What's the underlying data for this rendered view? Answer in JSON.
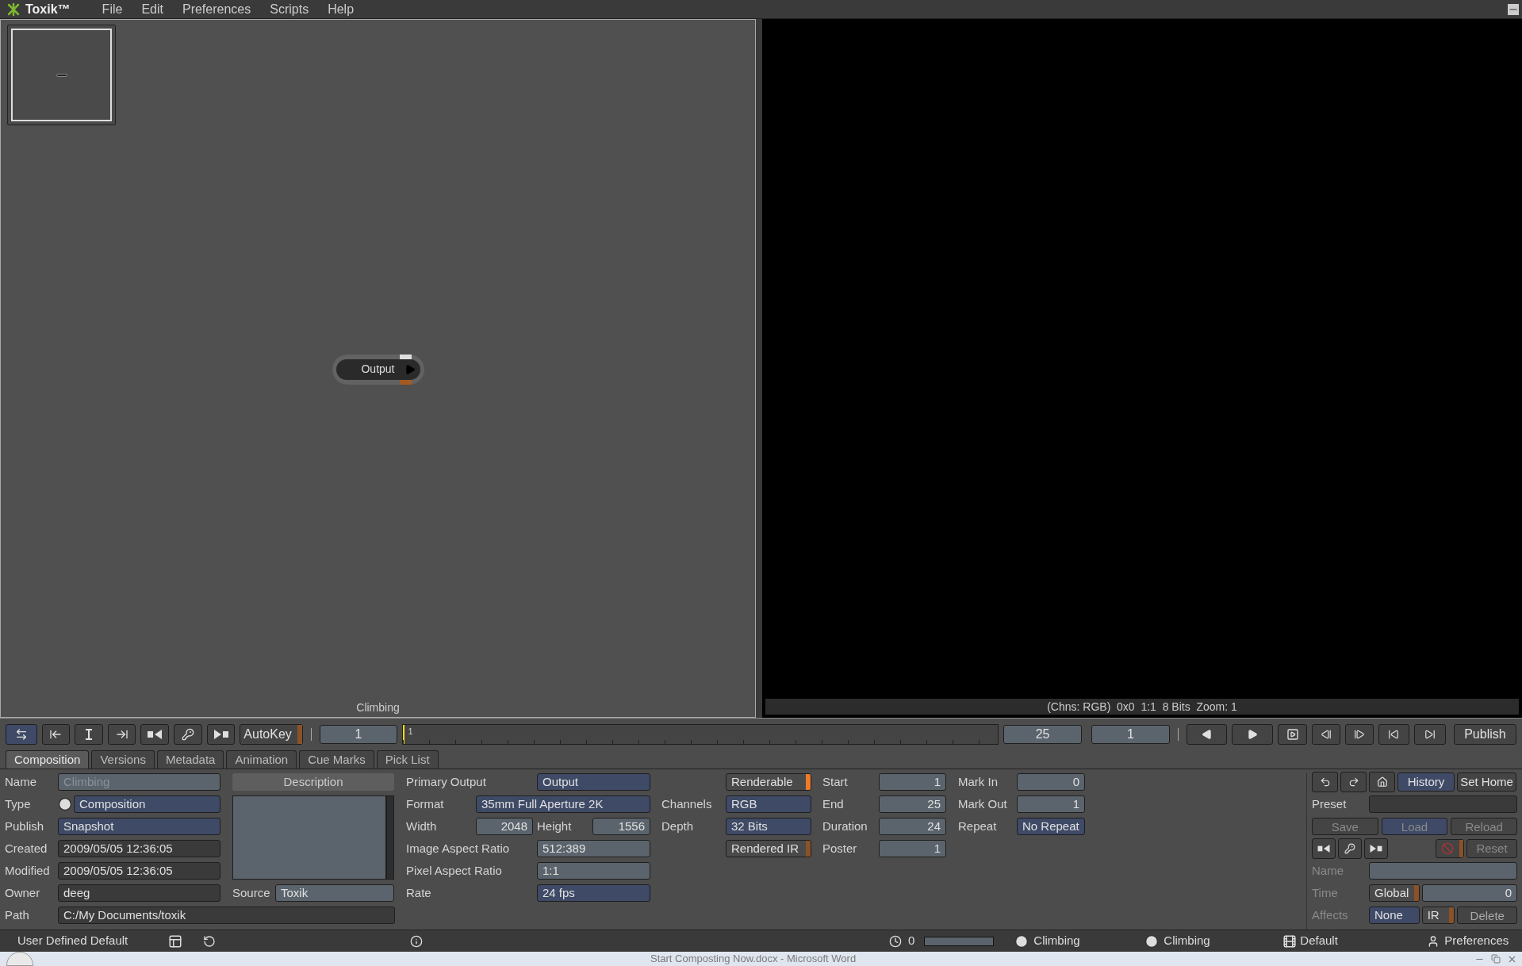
{
  "menu_bar": {
    "app_name": "Toxik™",
    "items": [
      "File",
      "Edit",
      "Preferences",
      "Scripts",
      "Help"
    ]
  },
  "schematic": {
    "node": {
      "label": "Output"
    },
    "footer": "Climbing"
  },
  "viewer": {
    "status": "(Chns: RGB)  0x0  1:1  8 Bits  Zoom: 1"
  },
  "transport": {
    "autokey": {
      "label": "AutoKey",
      "on": false
    },
    "current_frame": "1",
    "ruler_start": "1",
    "end_frame": "25",
    "frame_field": "1",
    "publish": "Publish"
  },
  "tabs": [
    {
      "label": "Composition",
      "selected": true
    },
    {
      "label": "Versions",
      "selected": false
    },
    {
      "label": "Metadata",
      "selected": false
    },
    {
      "label": "Animation",
      "selected": false
    },
    {
      "label": "Cue Marks",
      "selected": false
    },
    {
      "label": "Pick List",
      "selected": false
    }
  ],
  "general": [
    {
      "label": "Name",
      "value": "Climbing",
      "kind": "input",
      "disabled": true
    },
    {
      "label": "Type",
      "value": "Composition",
      "kind": "menu",
      "disabled": false
    },
    {
      "label": "Publish",
      "value": "Snapshot",
      "kind": "menu",
      "disabled": false
    },
    {
      "label": "Created",
      "value": "2009/05/05 12:36:05",
      "kind": "readonly",
      "disabled": false
    },
    {
      "label": "Modified",
      "value": "2009/05/05 12:36:05",
      "kind": "readonly",
      "disabled": false
    },
    {
      "label": "Owner",
      "value": "deeg",
      "kind": "readonly",
      "disabled": false
    }
  ],
  "path": {
    "label": "Path",
    "value": "C:/My Documents/toxik"
  },
  "description": {
    "title": "Description",
    "source_label": "Source",
    "source_value": "Toxik"
  },
  "format": {
    "primary_output": {
      "label": "Primary Output",
      "value": "Output"
    },
    "format": {
      "label": "Format",
      "value": "35mm Full Aperture 2K"
    },
    "width": {
      "label": "Width",
      "value": "2048"
    },
    "height": {
      "label": "Height",
      "value": "1556"
    },
    "image_aspect_ratio": {
      "label": "Image Aspect Ratio",
      "value": "512:389"
    },
    "pixel_aspect_ratio": {
      "label": "Pixel Aspect Ratio",
      "value": "1:1"
    },
    "rate": {
      "label": "Rate",
      "value": "24 fps"
    }
  },
  "image": [
    {
      "kind": "toggle",
      "value": "Renderable",
      "on": true
    },
    {
      "kind": "menu",
      "label": "Channels",
      "value": "RGB"
    },
    {
      "kind": "menu",
      "label": "Depth",
      "value": "32 Bits"
    },
    {
      "kind": "toggle",
      "value": "Rendered IR",
      "on": false
    }
  ],
  "range": [
    {
      "label": "Start",
      "value": "1",
      "kind": "number"
    },
    {
      "label": "End",
      "value": "25",
      "kind": "number"
    },
    {
      "label": "Duration",
      "value": "24",
      "kind": "number"
    },
    {
      "label": "Poster",
      "value": "1",
      "kind": "number"
    }
  ],
  "marks": [
    {
      "label": "Mark In",
      "value": "0",
      "kind": "number"
    },
    {
      "label": "Mark Out",
      "value": "1",
      "kind": "number"
    },
    {
      "label": "Repeat",
      "value": "No Repeat",
      "kind": "menu"
    }
  ],
  "presets": {
    "history": "History",
    "set_home": "Set Home",
    "preset_label": "Preset",
    "actions": [
      {
        "label": "Save",
        "kind": "button",
        "disabled": true
      },
      {
        "label": "Load",
        "kind": "menu",
        "disabled": true
      },
      {
        "label": "Reload",
        "kind": "button",
        "disabled": true
      }
    ],
    "cancel_on": false,
    "reset": "Reset",
    "name_label": "Name",
    "time_label": "Time",
    "time_mode": {
      "label": "Global",
      "on": false
    },
    "time_value": "0",
    "affects_label": "Affects",
    "affects": "None",
    "ir": {
      "label": "IR",
      "on": false
    },
    "delete": "Delete"
  },
  "status_bar": {
    "layout": "User Defined Default",
    "counter": "0",
    "level": 0,
    "composition": "Climbing",
    "version": "Climbing",
    "profile": "Default",
    "preferences": "Preferences"
  },
  "taskbar": {
    "window_title": "Start Composting Now.docx - Microsoft Word"
  }
}
